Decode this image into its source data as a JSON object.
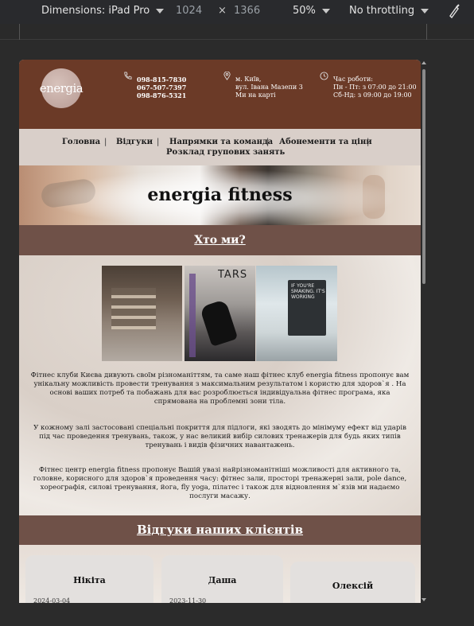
{
  "devtools": {
    "dimensions_label": "Dimensions: iPad Pro",
    "width": "1024",
    "times": "×",
    "height": "1366",
    "zoom": "50%",
    "throttling": "No throttling"
  },
  "header": {
    "logo_text": "energia",
    "phones": [
      "098-815-7830",
      "067-507-7397",
      "098-876-5321"
    ],
    "address": [
      "м. Київ,",
      "вул. Івана Мазепи 3",
      "Ми на карті"
    ],
    "hours": [
      "Час роботи:",
      "Пн - Пт: з 07:00 до 21:00",
      "Сб-Нд: з 09:00 до 19:00"
    ]
  },
  "nav": {
    "items": [
      "Головна",
      "Відгуки",
      "Напрямки та команда",
      "Абонементи та ціни",
      "Розклад групових занять"
    ],
    "separator": "|"
  },
  "hero": {
    "title": "energia fitness"
  },
  "about": {
    "heading": "Хто ми?",
    "photo2_text": "TARS",
    "photo3_text": "IF YOU'RE SMAKING. IT'S WORKING",
    "paragraphs": [
      "Фітнес клуби Києва дивують своїм різноманіттям, та саме наш фітнес клуб energia fitness пропонує вам унікальну можливість провести тренування з максимальним результатом і користю для здоров`я . На основі ваших потреб та побажань для вас розроблюється індивідуальна фітнес програма, яка спрямована на проблемні зони тіла.",
      "У кожному залі застосовані спеціальні покриття для підлоги, які зводять до мінімуму ефект від ударів під час проведення тренувань, також, у нас великий вибір силових тренажерів для будь яких типів тренувань і видів фізичних навантажень.",
      "Фітнес центр energia fitness пропонує Вашій увазі найрізноманітніші можливості для активного та, головне, корисного для здоров`я проведення часу: фітнес зали, просторі тренажерні зали, pole dance, хореографія, силові тренування, йога, fly yoga, пілатес і також для відновлення м`язів ми надаємо послуги масажу."
    ]
  },
  "reviews": {
    "heading": "Відгуки наших клієнтів",
    "items": [
      {
        "name": "Нікіта",
        "date": "2024-03-04"
      },
      {
        "name": "Даша",
        "date": "2023-11-30"
      },
      {
        "name": "Олексій",
        "date": ""
      }
    ]
  },
  "colors": {
    "header_brown": "#6b3a27",
    "section_bar": "#6f5148",
    "nav_bg": "#d9cfc9"
  }
}
